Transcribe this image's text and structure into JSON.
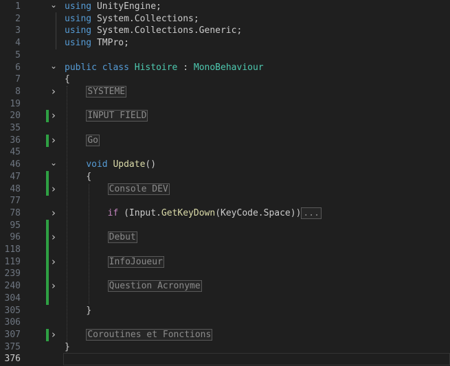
{
  "lines": [
    {
      "num": "1",
      "fold": "down",
      "git": false,
      "indent": 0,
      "tokens": [
        {
          "t": "kw",
          "v": "using"
        },
        {
          "t": "plain",
          "v": " UnityEngine;"
        }
      ]
    },
    {
      "num": "2",
      "fold": "",
      "git": false,
      "indent": 0,
      "tokens": [
        {
          "t": "kw",
          "v": "using"
        },
        {
          "t": "plain",
          "v": " System.Collections;"
        }
      ]
    },
    {
      "num": "3",
      "fold": "",
      "git": false,
      "indent": 0,
      "tokens": [
        {
          "t": "kw",
          "v": "using"
        },
        {
          "t": "plain",
          "v": " System.Collections.Generic;"
        }
      ]
    },
    {
      "num": "4",
      "fold": "",
      "git": false,
      "indent": 0,
      "tokens": [
        {
          "t": "kw",
          "v": "using"
        },
        {
          "t": "plain",
          "v": " TMPro;"
        }
      ]
    },
    {
      "num": "5",
      "fold": "",
      "git": false,
      "indent": 0,
      "tokens": []
    },
    {
      "num": "6",
      "fold": "down",
      "git": false,
      "indent": 0,
      "tokens": [
        {
          "t": "kw",
          "v": "public"
        },
        {
          "t": "plain",
          "v": " "
        },
        {
          "t": "kw",
          "v": "class"
        },
        {
          "t": "plain",
          "v": " "
        },
        {
          "t": "type",
          "v": "Histoire"
        },
        {
          "t": "plain",
          "v": " : "
        },
        {
          "t": "type",
          "v": "MonoBehaviour"
        }
      ]
    },
    {
      "num": "7",
      "fold": "",
      "git": false,
      "indent": 0,
      "tokens": [
        {
          "t": "plain",
          "v": "{"
        }
      ]
    },
    {
      "num": "8",
      "fold": "right",
      "git": false,
      "indent": 1,
      "tokens": [
        {
          "t": "region",
          "v": "SYSTEME"
        }
      ]
    },
    {
      "num": "19",
      "fold": "",
      "git": false,
      "indent": 1,
      "tokens": []
    },
    {
      "num": "20",
      "fold": "right",
      "git": true,
      "indent": 1,
      "tokens": [
        {
          "t": "region",
          "v": "INPUT FIELD"
        }
      ]
    },
    {
      "num": "35",
      "fold": "",
      "git": false,
      "indent": 1,
      "tokens": []
    },
    {
      "num": "36",
      "fold": "right",
      "git": true,
      "indent": 1,
      "tokens": [
        {
          "t": "region",
          "v": "Go"
        }
      ]
    },
    {
      "num": "45",
      "fold": "",
      "git": false,
      "indent": 1,
      "tokens": []
    },
    {
      "num": "46",
      "fold": "down",
      "git": false,
      "indent": 1,
      "tokens": [
        {
          "t": "kw",
          "v": "void"
        },
        {
          "t": "plain",
          "v": " "
        },
        {
          "t": "fn",
          "v": "Update"
        },
        {
          "t": "plain",
          "v": "()"
        }
      ]
    },
    {
      "num": "47",
      "fold": "",
      "git": true,
      "indent": 1,
      "tokens": [
        {
          "t": "plain",
          "v": "{"
        }
      ]
    },
    {
      "num": "48",
      "fold": "right",
      "git": true,
      "indent": 2,
      "tokens": [
        {
          "t": "region",
          "v": "Console DEV"
        }
      ]
    },
    {
      "num": "77",
      "fold": "",
      "git": false,
      "indent": 2,
      "tokens": []
    },
    {
      "num": "78",
      "fold": "right",
      "git": false,
      "indent": 2,
      "tokens": [
        {
          "t": "ctrl",
          "v": "if"
        },
        {
          "t": "plain",
          "v": " (Input."
        },
        {
          "t": "fn",
          "v": "GetKeyDown"
        },
        {
          "t": "plain",
          "v": "(KeyCode.Space))"
        },
        {
          "t": "ellipsis",
          "v": "..."
        }
      ]
    },
    {
      "num": "95",
      "fold": "",
      "git": true,
      "indent": 2,
      "tokens": []
    },
    {
      "num": "96",
      "fold": "right",
      "git": true,
      "indent": 2,
      "tokens": [
        {
          "t": "region",
          "v": "Debut"
        }
      ]
    },
    {
      "num": "118",
      "fold": "",
      "git": true,
      "indent": 2,
      "tokens": []
    },
    {
      "num": "119",
      "fold": "right",
      "git": true,
      "indent": 2,
      "tokens": [
        {
          "t": "region",
          "v": "InfoJoueur"
        }
      ]
    },
    {
      "num": "239",
      "fold": "",
      "git": true,
      "indent": 2,
      "tokens": []
    },
    {
      "num": "240",
      "fold": "right",
      "git": true,
      "indent": 2,
      "tokens": [
        {
          "t": "region",
          "v": "Question Acronyme"
        }
      ]
    },
    {
      "num": "304",
      "fold": "",
      "git": true,
      "indent": 2,
      "tokens": []
    },
    {
      "num": "305",
      "fold": "",
      "git": false,
      "indent": 1,
      "tokens": [
        {
          "t": "plain",
          "v": "}"
        }
      ]
    },
    {
      "num": "306",
      "fold": "",
      "git": false,
      "indent": 1,
      "tokens": []
    },
    {
      "num": "307",
      "fold": "right",
      "git": true,
      "indent": 1,
      "tokens": [
        {
          "t": "region",
          "v": "Coroutines et Fonctions"
        }
      ]
    },
    {
      "num": "375",
      "fold": "",
      "git": false,
      "indent": 0,
      "tokens": [
        {
          "t": "plain",
          "v": "}"
        }
      ]
    },
    {
      "num": "376",
      "fold": "",
      "git": false,
      "indent": 0,
      "current": true,
      "tokens": []
    }
  ],
  "icons": {
    "fold_down": "chevron-down-icon",
    "fold_right": "chevron-right-icon"
  },
  "colors": {
    "background": "#1f1f1f",
    "keyword": "#569cd6",
    "control": "#c586c0",
    "type": "#4ec9b0",
    "function": "#dcdcaa",
    "git_added": "#2ea043"
  }
}
